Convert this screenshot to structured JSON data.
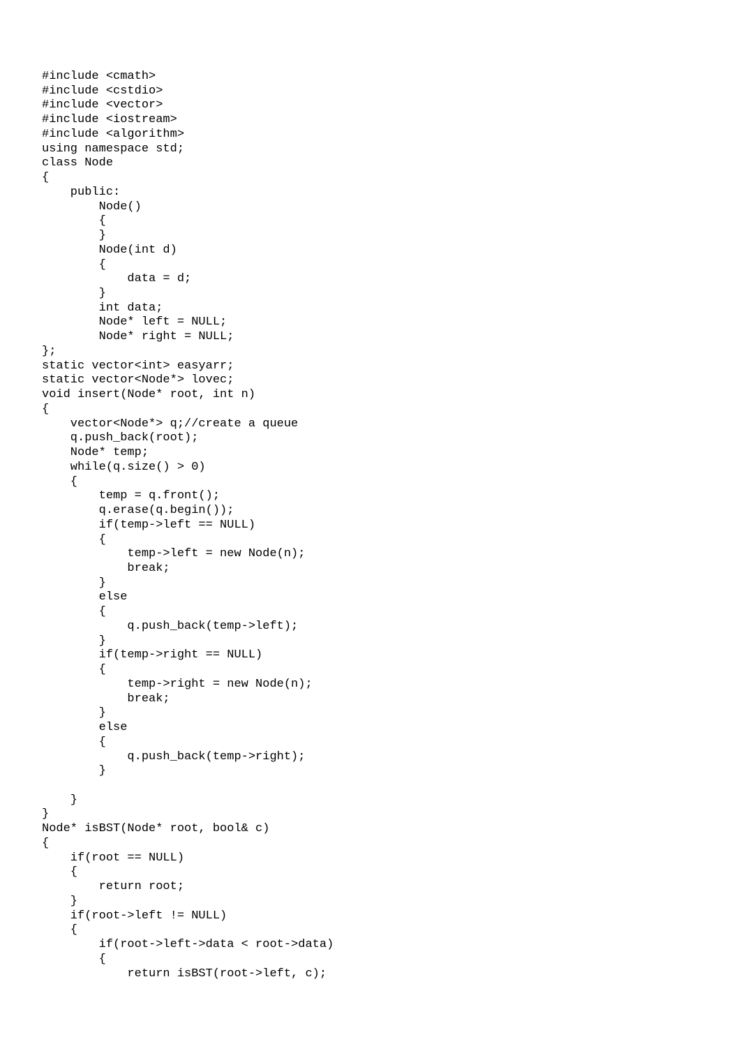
{
  "code": "#include <cmath>\n#include <cstdio>\n#include <vector>\n#include <iostream>\n#include <algorithm>\nusing namespace std;\nclass Node\n{\n    public:\n        Node()\n        {\n        }\n        Node(int d)\n        {\n            data = d;\n        }\n        int data;\n        Node* left = NULL;\n        Node* right = NULL;\n};\nstatic vector<int> easyarr;\nstatic vector<Node*> lovec;\nvoid insert(Node* root, int n)\n{\n    vector<Node*> q;//create a queue\n    q.push_back(root);\n    Node* temp;\n    while(q.size() > 0)\n    {\n        temp = q.front();\n        q.erase(q.begin());\n        if(temp->left == NULL)\n        {\n            temp->left = new Node(n);\n            break;\n        }\n        else\n        {\n            q.push_back(temp->left);\n        }\n        if(temp->right == NULL)\n        {\n            temp->right = new Node(n);\n            break;\n        }\n        else\n        {\n            q.push_back(temp->right);\n        }\n\n    }\n}\nNode* isBST(Node* root, bool& c)\n{\n    if(root == NULL)\n    {\n        return root;\n    }\n    if(root->left != NULL)\n    {\n        if(root->left->data < root->data)\n        {\n            return isBST(root->left, c);"
}
